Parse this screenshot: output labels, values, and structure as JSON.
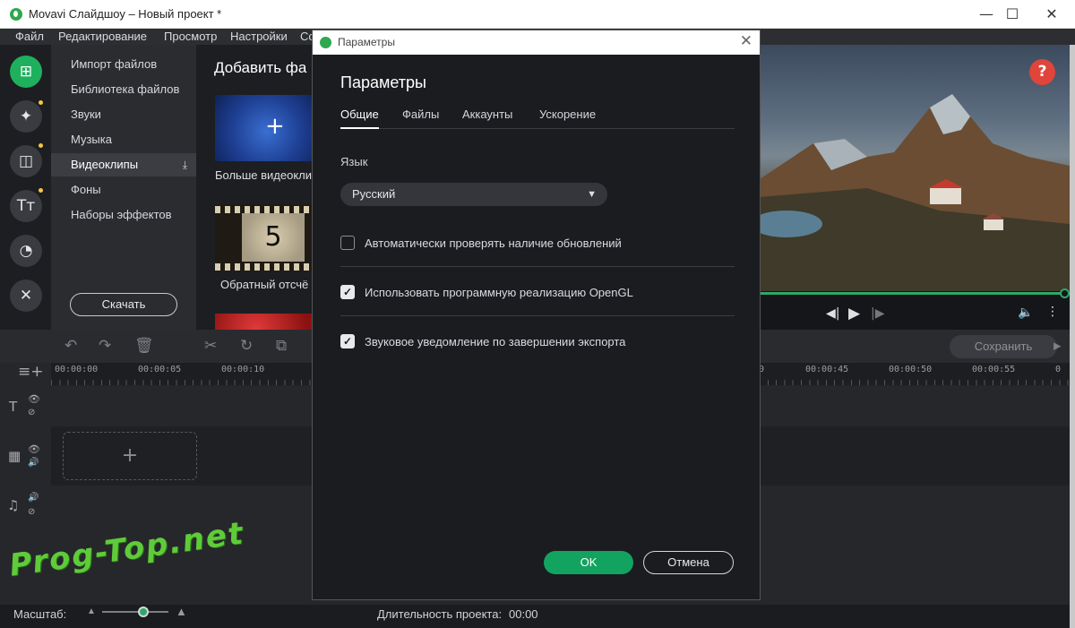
{
  "window": {
    "title": "Movavi Слайдшоу – Новый проект *",
    "minimize": "—",
    "maximize": "☐",
    "close": "✕"
  },
  "menu": [
    "Файл",
    "Редактирование",
    "Просмотр",
    "Настройки",
    "Со"
  ],
  "import_menu": {
    "items": [
      "Импорт файлов",
      "Библиотека файлов",
      "Звуки",
      "Музыка",
      "Видеоклипы",
      "Фоны",
      "Наборы эффектов"
    ],
    "active_index": 4,
    "download_label": "Скачать"
  },
  "content": {
    "heading": "Добавить фа",
    "thumbs": [
      {
        "label": "Больше видеокли"
      },
      {
        "label": "Обратный отсчё",
        "number": "5"
      }
    ]
  },
  "preview": {
    "help": "?",
    "progress_fraction": 1.0
  },
  "toolbar": {
    "save_label": "Сохранить"
  },
  "timeline": {
    "ruler": [
      "00:00:00",
      "00:00:05",
      "00:00:10",
      "0",
      "00:00:45",
      "00:00:50",
      "00:00:55",
      "0"
    ]
  },
  "bottom": {
    "zoom_label": "Масштаб:",
    "zoom_fraction": 0.6,
    "duration_label": "Длительность проекта:",
    "duration_value": "00:00"
  },
  "watermark": "Prog-Top.net",
  "dialog": {
    "window_title": "Параметры",
    "heading": "Параметры",
    "tabs": [
      "Общие",
      "Файлы",
      "Аккаунты",
      "Ускорение"
    ],
    "active_tab": 0,
    "language_label": "Язык",
    "language_value": "Русский",
    "options": [
      {
        "label": "Автоматически проверять наличие обновлений",
        "checked": false
      },
      {
        "label": "Использовать программную реализацию OpenGL",
        "checked": true
      },
      {
        "label": "Звуковое уведомление по завершении экспорта",
        "checked": true
      }
    ],
    "ok_label": "OK",
    "cancel_label": "Отмена"
  },
  "colors": {
    "accent_green": "#13a360",
    "help_red": "#e0443a"
  }
}
